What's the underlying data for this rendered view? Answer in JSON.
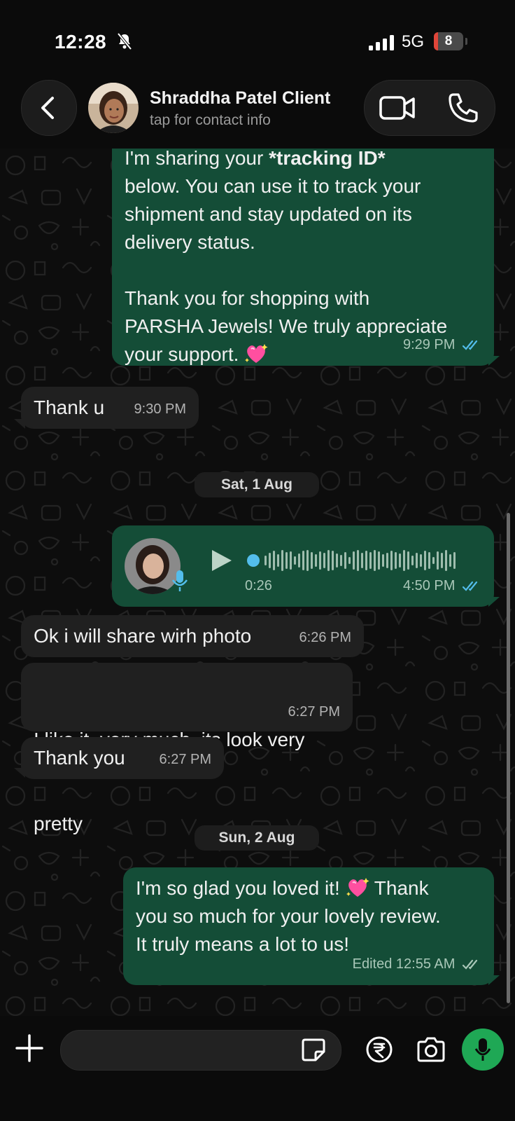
{
  "status_bar": {
    "time": "12:28",
    "network": "5G",
    "battery_level": "8",
    "battery_fraction": 0.08
  },
  "header": {
    "contact_name": "Shraddha Patel Client",
    "contact_subtitle": "tap for contact info"
  },
  "messages": [
    {
      "direction": "outgoing",
      "lines": [
        "I'm sharing your *tracking ID*",
        "below. You can use it to track your",
        "shipment and stay updated on its",
        "delivery status.",
        "",
        "Thank you for shopping with",
        "PARSHA Jewels! We truly appreciate",
        "your support."
      ],
      "time": "9:29 PM",
      "status": "read"
    },
    {
      "direction": "incoming",
      "text": "Thank u",
      "time": "9:30 PM"
    },
    {
      "date_separator": "Sat, 1 Aug"
    },
    {
      "direction": "outgoing",
      "type": "voice",
      "duration": "0:26",
      "time": "4:50 PM",
      "status": "read",
      "progress": 0.0
    },
    {
      "direction": "incoming",
      "text": "Ok i will share wirh photo",
      "time": "6:26 PM"
    },
    {
      "direction": "incoming",
      "lines": [
        "I like it  very much  its look very",
        "pretty"
      ],
      "time": "6:27 PM"
    },
    {
      "direction": "incoming",
      "text": "Thank you",
      "time": "6:27 PM"
    },
    {
      "date_separator": "Sun, 2 Aug"
    },
    {
      "direction": "outgoing",
      "lines": [
        "I'm so glad you loved it!",
        "you so much for your lovely review.",
        "It truly means a lot to us!"
      ],
      "line1_after_emoji": "Thank",
      "edited_label": "Edited",
      "time": "12:55 AM",
      "status": "delivered"
    }
  ],
  "input": {
    "placeholder": ""
  },
  "colors": {
    "outgoing_bubble": "#144d37",
    "incoming_bubble": "#202020",
    "read_ticks": "#53bdeb",
    "mic_button": "#1fa855"
  },
  "icons": [
    "bell-slash-icon",
    "signal-icon",
    "back-chevron-icon",
    "video-call-icon",
    "phone-icon",
    "play-icon",
    "mic-icon",
    "plus-icon",
    "sticker-icon",
    "rupee-icon",
    "camera-icon",
    "double-check-icon",
    "sparkling-heart-icon"
  ]
}
